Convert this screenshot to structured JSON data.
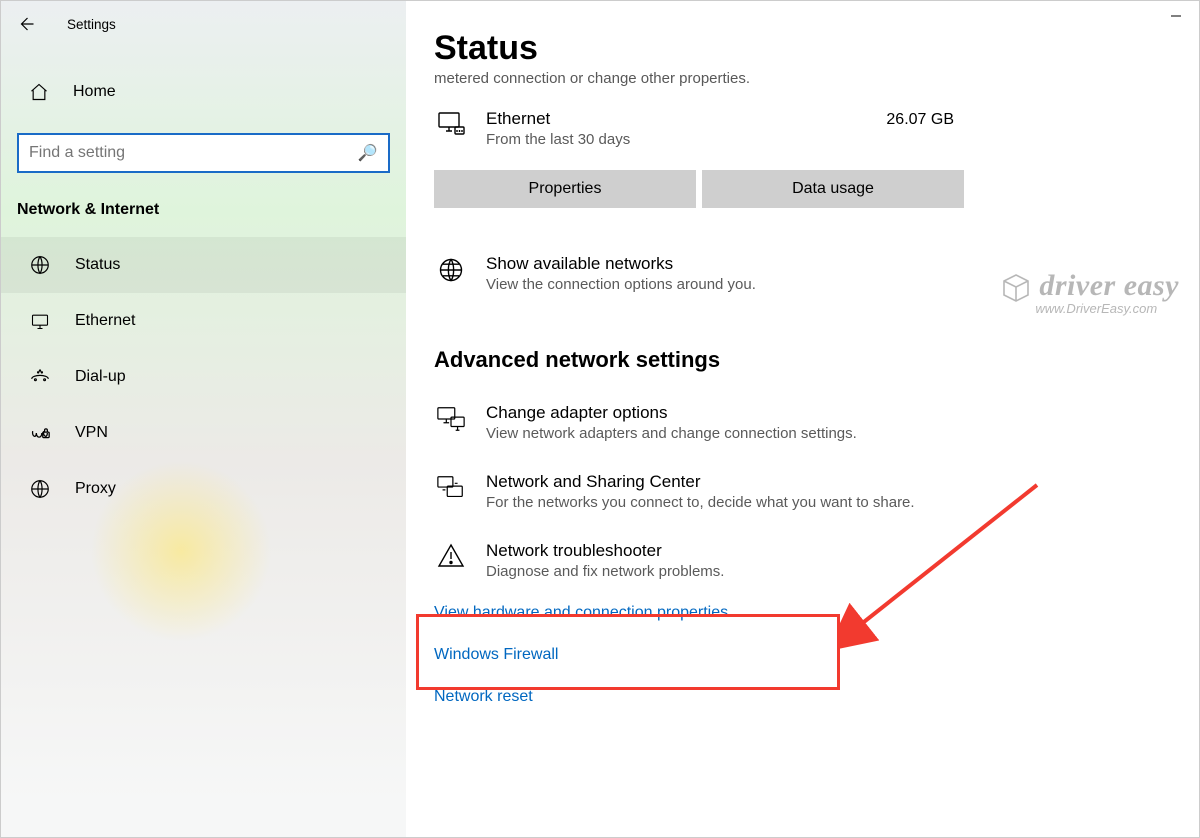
{
  "titlebar": {
    "app_name": "Settings"
  },
  "sidebar": {
    "home": "Home",
    "search_placeholder": "Find a setting",
    "section_label": "Network & Internet",
    "items": [
      {
        "label": "Status"
      },
      {
        "label": "Ethernet"
      },
      {
        "label": "Dial-up"
      },
      {
        "label": "VPN"
      },
      {
        "label": "Proxy"
      }
    ]
  },
  "main": {
    "page_title": "Status",
    "truncated_line": "metered connection or change other properties.",
    "ethernet": {
      "name": "Ethernet",
      "sub": "From the last 30 days",
      "data": "26.07 GB"
    },
    "buttons": {
      "properties": "Properties",
      "data_usage": "Data usage"
    },
    "available": {
      "title": "Show available networks",
      "sub": "View the connection options around you."
    },
    "adv_header": "Advanced network settings",
    "adapter": {
      "title": "Change adapter options",
      "sub": "View network adapters and change connection settings."
    },
    "sharing": {
      "title": "Network and Sharing Center",
      "sub": "For the networks you connect to, decide what you want to share."
    },
    "troubleshooter": {
      "title": "Network troubleshooter",
      "sub": "Diagnose and fix network problems."
    },
    "links": {
      "hardware": "View hardware and connection properties",
      "firewall": "Windows Firewall",
      "reset": "Network reset"
    }
  },
  "watermark": {
    "brand": "driver easy",
    "url": "www.DriverEasy.com"
  }
}
